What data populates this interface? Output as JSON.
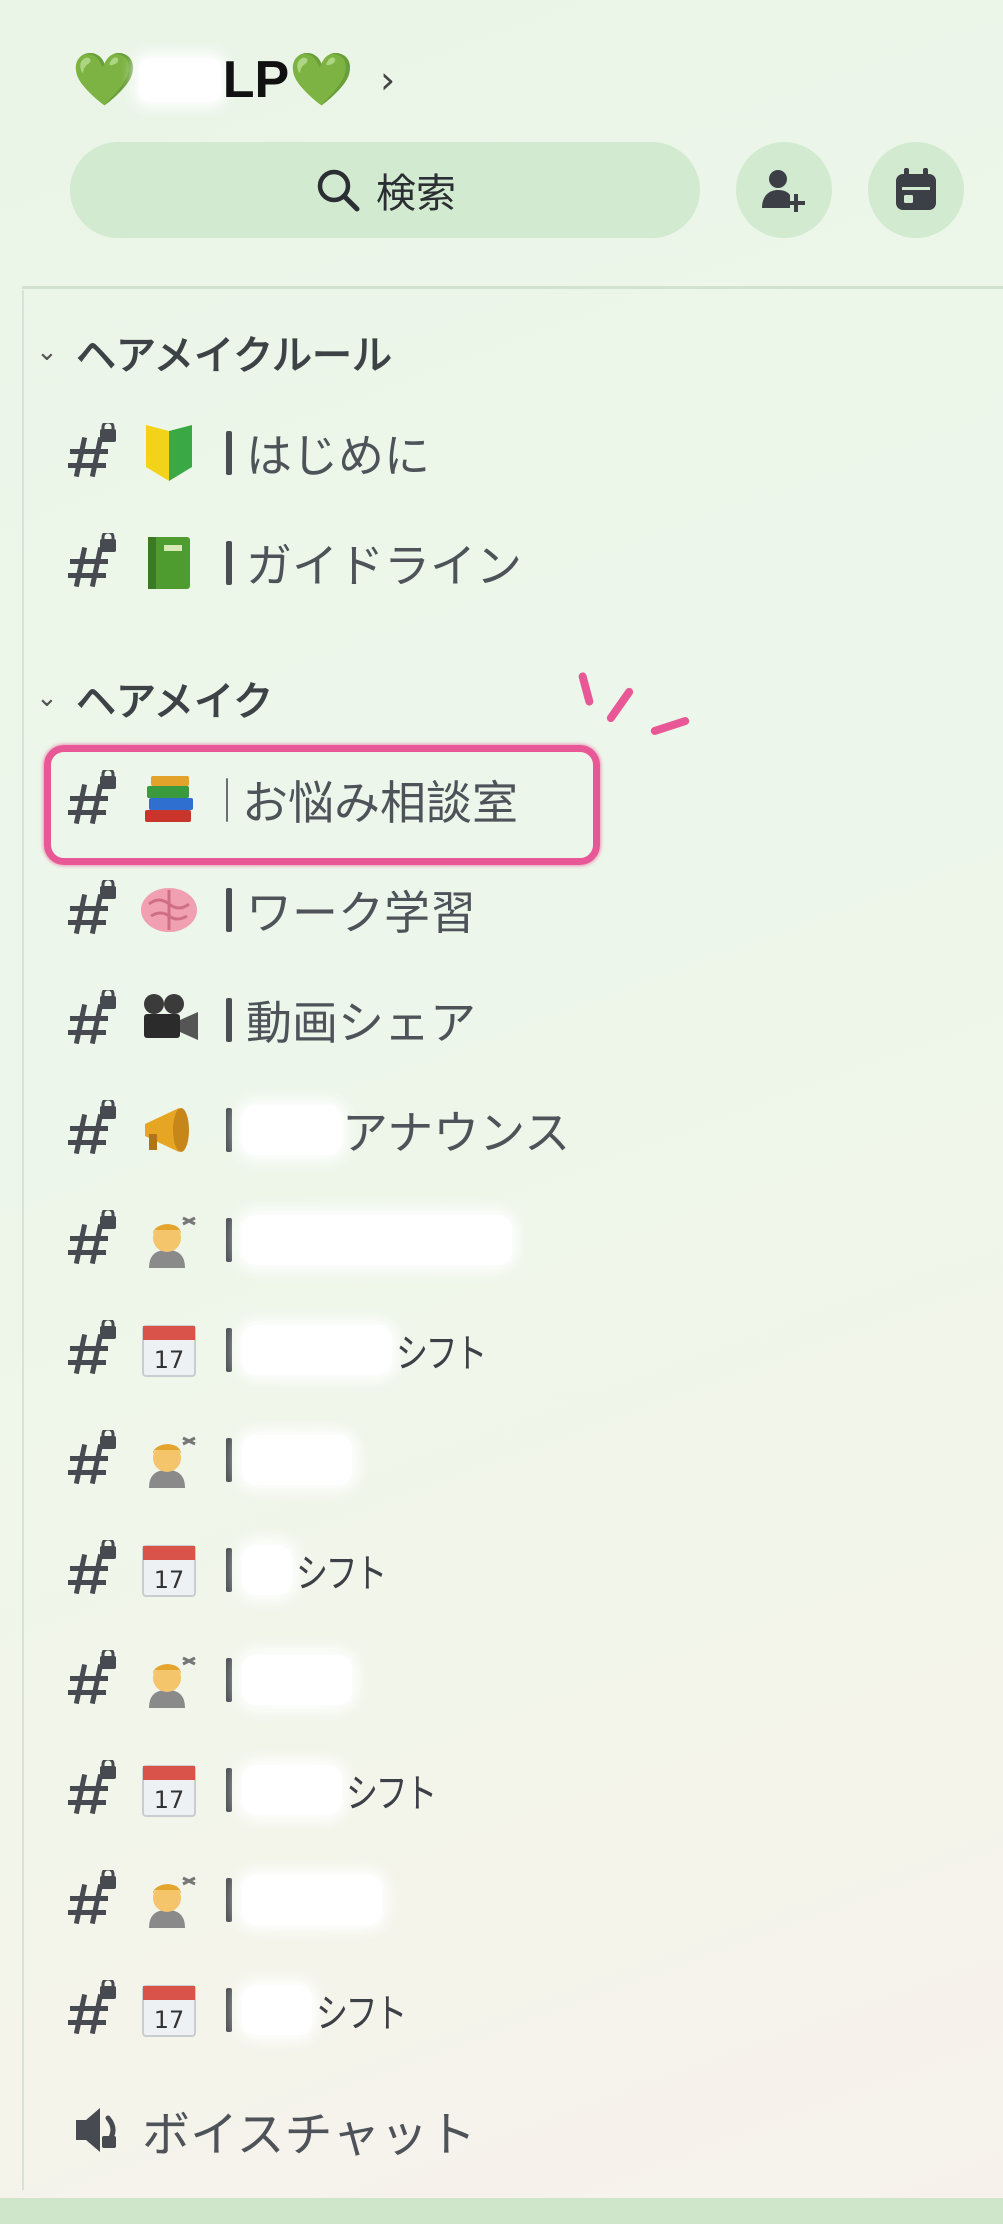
{
  "server": {
    "name": "LP",
    "heart_left": "💚",
    "heart_right": "💚",
    "chevron": "›"
  },
  "search": {
    "label": "検索"
  },
  "header_buttons": [
    {
      "name": "invite-icon"
    },
    {
      "name": "calendar-icon"
    }
  ],
  "categories": [
    {
      "label": "ヘアメイクルール",
      "channels": [
        {
          "emoji": "🔰",
          "name": "はじめに"
        },
        {
          "emoji": "📗",
          "name": "ガイドライン"
        }
      ]
    },
    {
      "label": "ヘアメイク",
      "channels": [
        {
          "emoji": "📚",
          "name": "お悩み相談室",
          "highlighted": true
        },
        {
          "emoji": "🧠",
          "name": "ワーク学習"
        },
        {
          "emoji": "🎥",
          "name": "動画シェア"
        },
        {
          "emoji": "📣",
          "name": "アナウンス"
        },
        {
          "emoji": "💇‍♂️",
          "name": ""
        },
        {
          "emoji": "📅",
          "name": "シフト"
        },
        {
          "emoji": "💇‍♂️",
          "name": ""
        },
        {
          "emoji": "📅",
          "name": "シフト"
        },
        {
          "emoji": "💇‍♂️",
          "name": ""
        },
        {
          "emoji": "📅",
          "name": "シフト"
        },
        {
          "emoji": "💇‍♂️",
          "name": ""
        },
        {
          "emoji": "📅",
          "name": "シフト"
        }
      ]
    }
  ],
  "voice_channel": {
    "label": "ボイスチャット"
  },
  "colors": {
    "highlight": "#e85896",
    "button_bg": "#d2ebd0",
    "background": "#eaf5e8"
  }
}
